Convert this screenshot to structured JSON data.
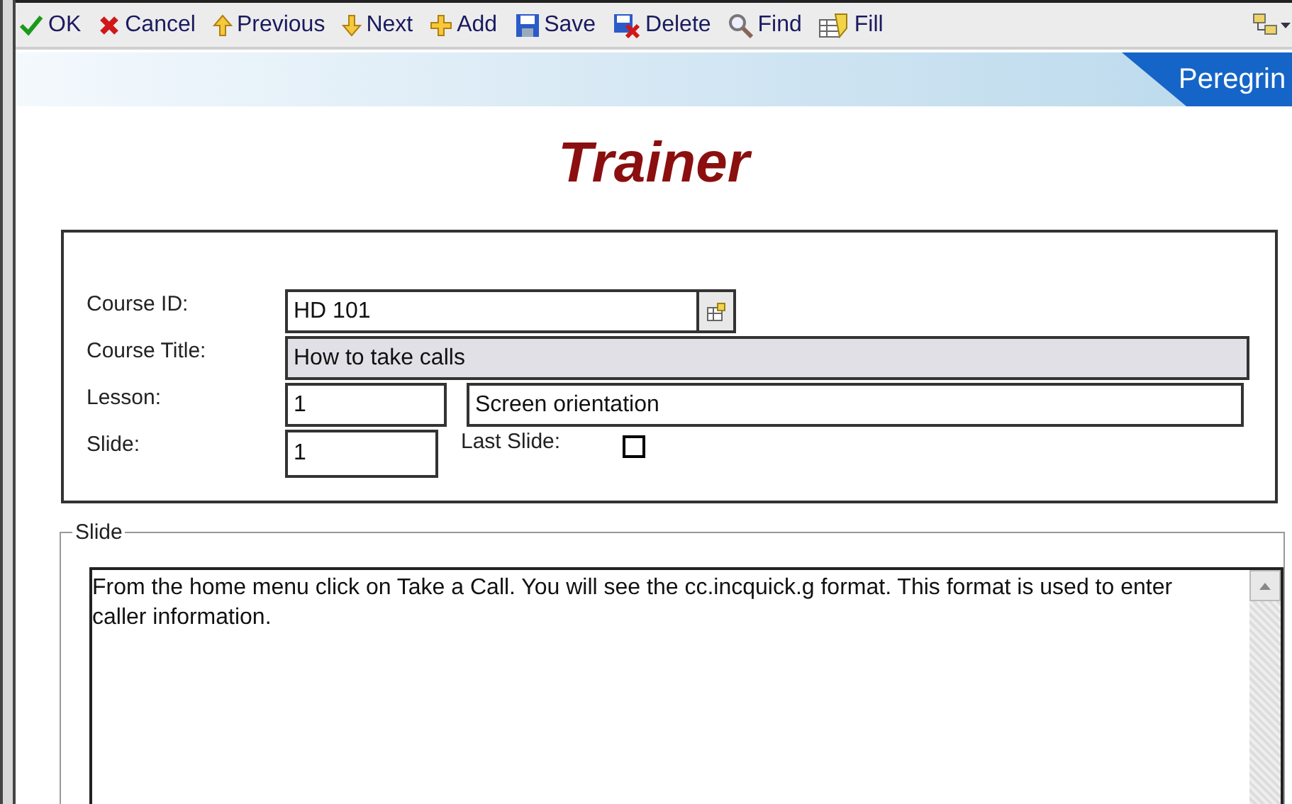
{
  "toolbar": [
    {
      "kind": "ok",
      "label": "OK"
    },
    {
      "kind": "cancel",
      "label": "Cancel"
    },
    {
      "kind": "previous",
      "label": "Previous"
    },
    {
      "kind": "next",
      "label": "Next"
    },
    {
      "kind": "add",
      "label": "Add"
    },
    {
      "kind": "save",
      "label": "Save"
    },
    {
      "kind": "delete",
      "label": "Delete"
    },
    {
      "kind": "find",
      "label": "Find"
    },
    {
      "kind": "fill",
      "label": "Fill"
    }
  ],
  "banner": {
    "brand": "Peregrin"
  },
  "title": "Trainer",
  "form": {
    "course_id": {
      "label": "Course ID:",
      "value": "HD 101"
    },
    "course_title": {
      "label": "Course Title:",
      "value": "How to take calls"
    },
    "lesson": {
      "label": "Lesson:",
      "number": "1",
      "name": "Screen orientation"
    },
    "slide": {
      "label": "Slide:",
      "value": "1"
    },
    "last_slide": {
      "label": "Last Slide:",
      "checked": false
    }
  },
  "slide_panel": {
    "legend": "Slide",
    "text": "From the home menu click on Take a Call. You will see the cc.incquick.g format. This format is used to enter caller information."
  }
}
